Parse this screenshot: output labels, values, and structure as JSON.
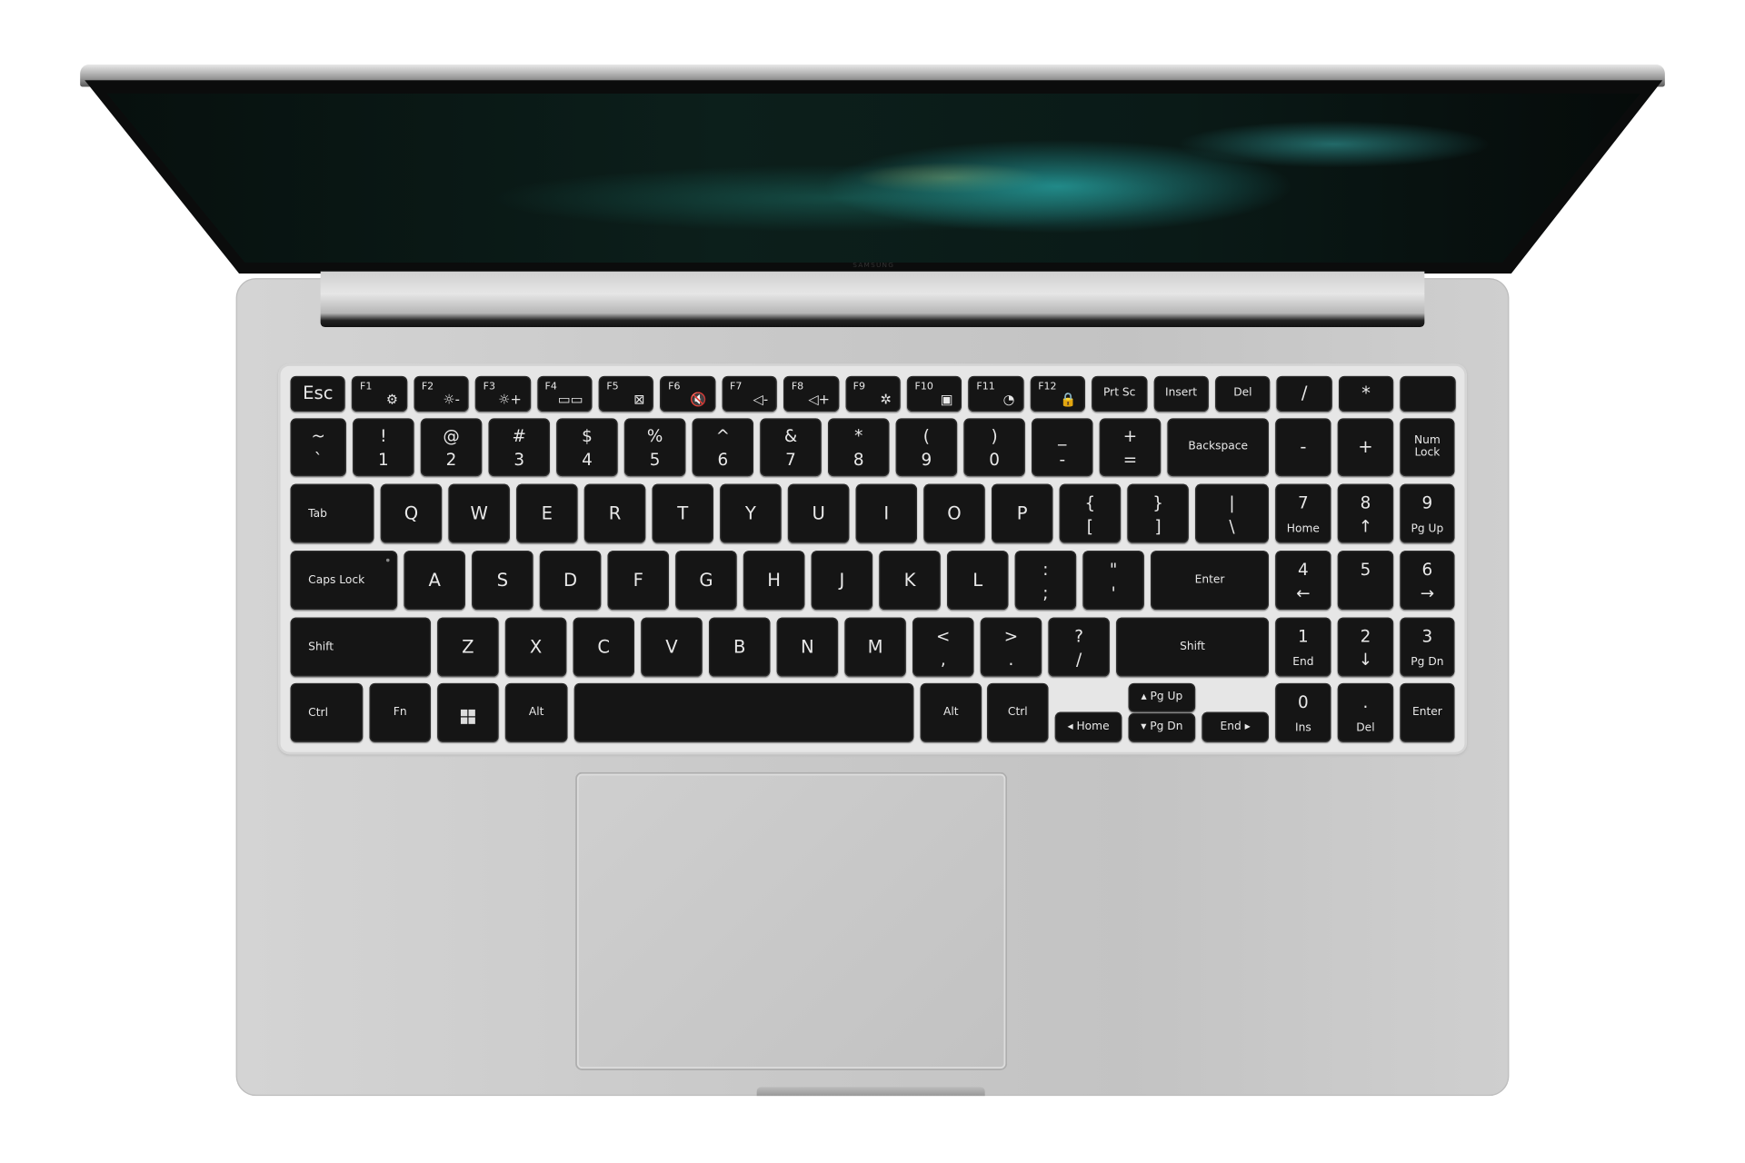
{
  "brand": "SAMSUNG",
  "colors": {
    "chassis": "#cacaca",
    "key": "#151515",
    "legend": "#e8e8e8",
    "screen_accent": "#28aaaa"
  },
  "keyboard": {
    "rows": [
      [
        {
          "c": "Esc"
        },
        {
          "fn": "F1",
          "icon": "settings-icon",
          "g": "⚙"
        },
        {
          "fn": "F2",
          "icon": "brightness-down-icon",
          "g": "☼-"
        },
        {
          "fn": "F3",
          "icon": "brightness-up-icon",
          "g": "☼+"
        },
        {
          "fn": "F4",
          "icon": "display-switch-icon",
          "g": "▭▭"
        },
        {
          "fn": "F5",
          "icon": "touchpad-off-icon",
          "g": "⊠"
        },
        {
          "fn": "F6",
          "icon": "mute-icon",
          "g": "🔇"
        },
        {
          "fn": "F7",
          "icon": "volume-down-icon",
          "g": "◁-"
        },
        {
          "fn": "F8",
          "icon": "volume-up-icon",
          "g": "◁+"
        },
        {
          "fn": "F9",
          "icon": "keyboard-backlight-icon",
          "g": "✲"
        },
        {
          "fn": "F10",
          "icon": "camera-lock-icon",
          "g": "▣"
        },
        {
          "fn": "F11",
          "icon": "performance-icon",
          "g": "◔"
        },
        {
          "fn": "F12",
          "icon": "fn-lock-icon",
          "g": "🔒"
        },
        {
          "c": "Prt Sc",
          "s": 1
        },
        {
          "c": "Insert",
          "s": 1
        },
        {
          "c": "Del",
          "s": 1
        },
        {
          "c": "/"
        },
        {
          "c": "*"
        },
        {
          "c": ""
        }
      ],
      [
        {
          "t": "~",
          "b": "`"
        },
        {
          "t": "!",
          "b": "1"
        },
        {
          "t": "@",
          "b": "2"
        },
        {
          "t": "#",
          "b": "3"
        },
        {
          "t": "$",
          "b": "4"
        },
        {
          "t": "%",
          "b": "5"
        },
        {
          "t": "^",
          "b": "6"
        },
        {
          "t": "&",
          "b": "7"
        },
        {
          "t": "*",
          "b": "8"
        },
        {
          "t": "(",
          "b": "9"
        },
        {
          "t": ")",
          "b": "0"
        },
        {
          "t": "_",
          "b": "-"
        },
        {
          "t": "+",
          "b": "="
        },
        {
          "c": "Backspace",
          "s": 1
        },
        {
          "c": "-"
        },
        {
          "c": "+"
        },
        {
          "c": "Num\nLock",
          "s": 1
        }
      ],
      [
        {
          "l": "Tab"
        },
        {
          "c": "Q"
        },
        {
          "c": "W"
        },
        {
          "c": "E"
        },
        {
          "c": "R"
        },
        {
          "c": "T"
        },
        {
          "c": "Y"
        },
        {
          "c": "U"
        },
        {
          "c": "I"
        },
        {
          "c": "O"
        },
        {
          "c": "P"
        },
        {
          "t": "{",
          "b": "["
        },
        {
          "t": "}",
          "b": "]"
        },
        {
          "t": "|",
          "b": "\\"
        },
        {
          "t": "7",
          "b": "Home",
          "bs": 1
        },
        {
          "t": "8",
          "b": "↑"
        },
        {
          "t": "9",
          "b": "Pg Up",
          "bs": 1
        }
      ],
      [
        {
          "l": "Caps Lock",
          "led": 1
        },
        {
          "c": "A"
        },
        {
          "c": "S"
        },
        {
          "c": "D"
        },
        {
          "c": "F"
        },
        {
          "c": "G"
        },
        {
          "c": "H"
        },
        {
          "c": "J"
        },
        {
          "c": "K"
        },
        {
          "c": "L"
        },
        {
          "t": ":",
          "b": ";"
        },
        {
          "t": "\"",
          "b": "'"
        },
        {
          "c": "Enter",
          "s": 1
        },
        {
          "t": "4",
          "b": "←"
        },
        {
          "t": "5",
          "b": ""
        },
        {
          "t": "6",
          "b": "→"
        }
      ],
      [
        {
          "l": "Shift"
        },
        {
          "c": "Z"
        },
        {
          "c": "X"
        },
        {
          "c": "C"
        },
        {
          "c": "V"
        },
        {
          "c": "B"
        },
        {
          "c": "N"
        },
        {
          "c": "M"
        },
        {
          "t": "<",
          "b": ","
        },
        {
          "t": ">",
          "b": "."
        },
        {
          "t": "?",
          "b": "/"
        },
        {
          "c": "Shift",
          "s": 1
        },
        {
          "t": "1",
          "b": "End",
          "bs": 1
        },
        {
          "t": "2",
          "b": "↓"
        },
        {
          "t": "3",
          "b": "Pg Dn",
          "bs": 1
        }
      ],
      [
        {
          "l": "Ctrl"
        },
        {
          "c": "Fn",
          "s": 1
        },
        {
          "win": 1
        },
        {
          "c": "Alt",
          "s": 1
        },
        {
          "c": ""
        },
        {
          "c": "Alt",
          "s": 1
        },
        {
          "c": "Ctrl",
          "s": 1
        },
        {
          "c": "◂ Home",
          "s": 1
        },
        {
          "c": "▴ Pg Up",
          "s": 1
        },
        {
          "c": "▾ Pg Dn",
          "s": 1
        },
        {
          "c": "End ▸",
          "s": 1
        },
        {
          "t": "0",
          "b": "Ins",
          "bs": 1
        },
        {
          "t": ".",
          "b": "Del",
          "bs": 1
        },
        {
          "c": "Enter",
          "s": 1
        }
      ]
    ]
  }
}
